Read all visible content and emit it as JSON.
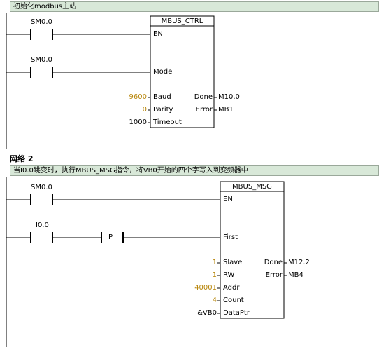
{
  "network1": {
    "comment": "初始化modbus主站",
    "contact1": "SM0.0",
    "contact2": "SM0.0",
    "block": {
      "title": "MBUS_CTRL",
      "en": "EN",
      "mode": "Mode",
      "baud_pin": "Baud",
      "parity_pin": "Parity",
      "timeout_pin": "Timeout",
      "done_pin": "Done",
      "error_pin": "Error",
      "baud_value": "9600",
      "parity_value": "0",
      "timeout_value": "1000",
      "done_out": "M10.0",
      "error_out": "MB1"
    }
  },
  "network2": {
    "label": "网络 2",
    "comment": "当I0.0跳变时，执行MBUS_MSG指令，将VB0开始的四个字写入到变频器中",
    "contact1": "SM0.0",
    "contact2": "I0.0",
    "pos_edge": "P",
    "block": {
      "title": "MBUS_MSG",
      "en": "EN",
      "first": "First",
      "slave_pin": "Slave",
      "rw_pin": "RW",
      "addr_pin": "Addr",
      "count_pin": "Count",
      "dataptr_pin": "DataPtr",
      "done_pin": "Done",
      "error_pin": "Error",
      "slave_value": "1",
      "rw_value": "1",
      "addr_value": "40001",
      "count_value": "4",
      "dataptr_value": "&VB0",
      "done_out": "M12.2",
      "error_out": "MB4"
    }
  }
}
